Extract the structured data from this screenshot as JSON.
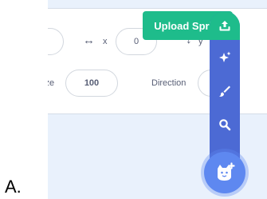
{
  "option_label": "A.",
  "tooltip": {
    "text": "Upload Sprite"
  },
  "sprite_info": {
    "x_label": "x",
    "y_label": "y",
    "x_value": "0",
    "size_label": "ize",
    "size_value": "100",
    "direction_label": "Direction"
  },
  "menu": {
    "items": [
      {
        "name": "upload",
        "icon": "upload-icon"
      },
      {
        "name": "surprise",
        "icon": "sparkle-icon"
      },
      {
        "name": "paint",
        "icon": "paintbrush-icon"
      },
      {
        "name": "search",
        "icon": "search-icon"
      }
    ],
    "main_icon": "cat-add-icon"
  },
  "colors": {
    "accent_green": "#1ebc8b",
    "menu_blue": "#4c6ad4",
    "main_button_blue": "#5e88f0"
  }
}
